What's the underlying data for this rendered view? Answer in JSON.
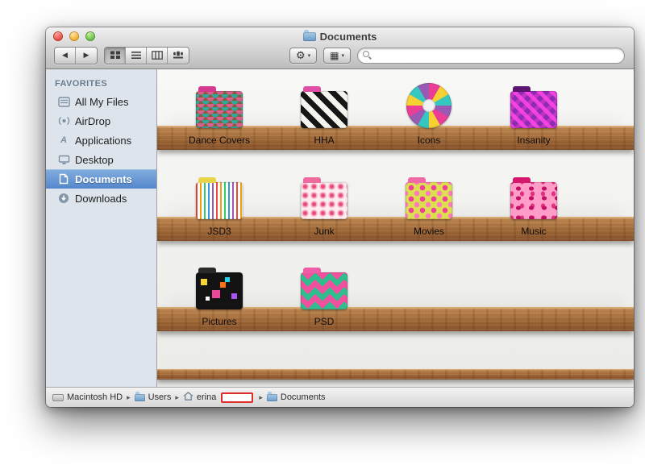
{
  "window": {
    "title": "Documents"
  },
  "toolbar": {
    "back_glyph": "◀",
    "forward_glyph": "▶",
    "view_modes": [
      {
        "name": "icon-view",
        "selected": true
      },
      {
        "name": "list-view",
        "selected": false
      },
      {
        "name": "column-view",
        "selected": false
      },
      {
        "name": "coverflow-view",
        "selected": false
      }
    ],
    "gear_glyph": "⚙",
    "arrange_glyph": "▦",
    "dropdown_glyph": "▾",
    "search": {
      "placeholder": "",
      "value": ""
    }
  },
  "sidebar": {
    "header": "FAVORITES",
    "items": [
      {
        "label": "All My Files",
        "icon": "all-my-files-icon",
        "selected": false
      },
      {
        "label": "AirDrop",
        "icon": "airdrop-icon",
        "selected": false
      },
      {
        "label": "Applications",
        "icon": "applications-icon",
        "selected": false
      },
      {
        "label": "Desktop",
        "icon": "desktop-icon",
        "selected": false
      },
      {
        "label": "Documents",
        "icon": "documents-icon",
        "selected": true
      },
      {
        "label": "Downloads",
        "icon": "downloads-icon",
        "selected": false
      }
    ]
  },
  "content": {
    "folders": [
      {
        "name": "Dance Covers"
      },
      {
        "name": "HHA"
      },
      {
        "name": "Icons"
      },
      {
        "name": "Insanity"
      },
      {
        "name": "JSD3"
      },
      {
        "name": "Junk"
      },
      {
        "name": "Movies"
      },
      {
        "name": "Music"
      },
      {
        "name": "Pictures"
      },
      {
        "name": "PSD"
      }
    ]
  },
  "pathbar": {
    "separator": "▸",
    "items": [
      {
        "label": "Macintosh HD",
        "icon": "hard-drive-icon"
      },
      {
        "label": "Users",
        "icon": "folder-icon"
      },
      {
        "label": "erina",
        "icon": "home-icon",
        "redacted": true
      },
      {
        "label": "Documents",
        "icon": "folder-icon"
      }
    ]
  },
  "colors": {
    "sidebar_selection_blue": "#5486cc",
    "wood_shelf": "#9c6534",
    "redaction_red": "#e02b2b"
  }
}
